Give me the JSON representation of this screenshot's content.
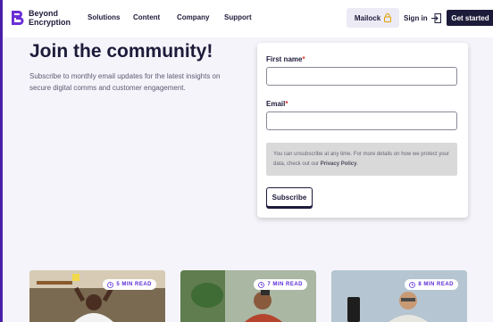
{
  "header": {
    "logo": {
      "line1": "Beyond",
      "line2": "Encryption"
    },
    "nav": [
      "Solutions",
      "Content",
      "Company",
      "Support"
    ],
    "mailock": "Mailock",
    "signin": "Sign in",
    "get_started": "Get started"
  },
  "hero": {
    "title": "Join the community!",
    "subtitle": "Subscribe to monthly email updates for the latest insights on secure digital comms and customer engagement."
  },
  "form": {
    "first_name_label": "First name",
    "email_label": "Email",
    "required_mark": "*",
    "notice_text": "You can unsubscribe at any time. For more details on how we protect your data, check out our",
    "notice_link": "Privacy Policy",
    "notice_end": ".",
    "subscribe": "Subscribe"
  },
  "articles": [
    {
      "read_time": "5 MIN READ"
    },
    {
      "read_time": "7 MIN READ"
    },
    {
      "read_time": "8 MIN READ"
    }
  ],
  "colors": {
    "brand": "#4a1fa8",
    "dark": "#1d1b3a",
    "badge": "#5b2bd6"
  }
}
